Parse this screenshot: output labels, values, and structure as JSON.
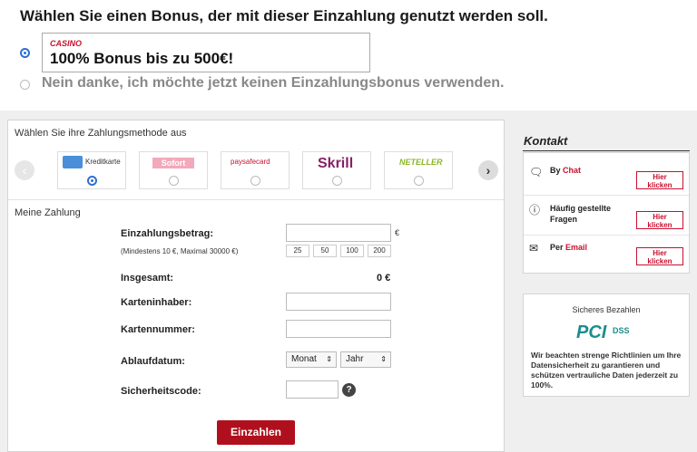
{
  "bonus": {
    "title": "Wählen Sie einen Bonus, der mit dieser Einzahlung genutzt werden soll.",
    "option1_tag": "CASINO",
    "option1_text": "100% Bonus bis zu 500€!",
    "option2_text": "Nein danke, ich möchte jetzt keinen Einzahlungsbonus verwenden."
  },
  "payment_methods": {
    "label": "Wählen Sie ihre Zahlungsmethode aus",
    "items": [
      {
        "name": "Kreditkarte",
        "selected": true
      },
      {
        "name": "Sofort",
        "selected": false
      },
      {
        "name": "paysafecard",
        "selected": false
      },
      {
        "name": "Skrill",
        "selected": false
      },
      {
        "name": "NETELLER",
        "selected": false
      }
    ]
  },
  "form": {
    "section_title": "Meine Zahlung",
    "amount_label": "Einzahlungsbetrag:",
    "amount_hint": "(Mindestens 10 €, Maximal 30000 €)",
    "currency": "€",
    "quick_amounts": [
      "25",
      "50",
      "100",
      "200"
    ],
    "total_label": "Insgesamt:",
    "total_value": "0 €",
    "holder_label": "Karteninhaber:",
    "number_label": "Kartennummer:",
    "expiry_label": "Ablaufdatum:",
    "month_select": "Monat",
    "year_select": "Jahr",
    "cvv_label": "Sicherheitscode:",
    "help_symbol": "?",
    "submit_label": "Einzahlen"
  },
  "kontakt": {
    "title": "Kontakt",
    "chat_prefix": "By ",
    "chat_link": "Chat",
    "faq_link": "Häufig gestellte Fragen",
    "email_prefix": "Per ",
    "email_link": "Email",
    "button_line1": "Hier",
    "button_line2": "klicken"
  },
  "secure": {
    "title": "Sicheres Bezahlen",
    "logo_pci": "PCI",
    "logo_dss": "DSS",
    "text": "Wir beachten strenge Richtlinien um Ihre Datensicherheit zu garantieren und schützen vertrauliche Daten jederzeit zu 100%."
  }
}
